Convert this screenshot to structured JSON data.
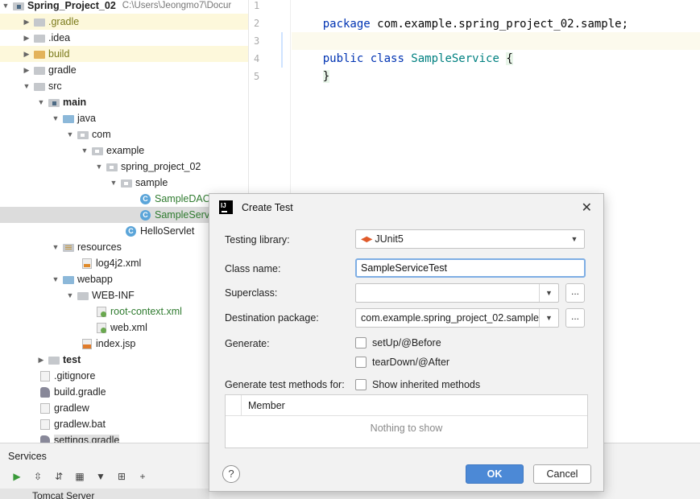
{
  "project_tree": {
    "root": {
      "label": "Spring_Project_02",
      "path": "C:\\Users\\Jeongmo7\\Docur"
    },
    "items": [
      {
        "label": ".gradle"
      },
      {
        "label": ".idea"
      },
      {
        "label": "build"
      },
      {
        "label": "gradle"
      },
      {
        "label": "src"
      },
      {
        "label": "main"
      },
      {
        "label": "java"
      },
      {
        "label": "com"
      },
      {
        "label": "example"
      },
      {
        "label": "spring_project_02"
      },
      {
        "label": "sample"
      },
      {
        "label": "SampleDAO"
      },
      {
        "label": "SampleServic"
      },
      {
        "label": "HelloServlet"
      },
      {
        "label": "resources"
      },
      {
        "label": "log4j2.xml"
      },
      {
        "label": "webapp"
      },
      {
        "label": "WEB-INF"
      },
      {
        "label": "root-context.xml"
      },
      {
        "label": "web.xml"
      },
      {
        "label": "index.jsp"
      },
      {
        "label": "test"
      },
      {
        "label": ".gitignore"
      },
      {
        "label": "build.gradle"
      },
      {
        "label": "gradlew"
      },
      {
        "label": "gradlew.bat"
      },
      {
        "label": "settings.gradle"
      }
    ],
    "class_icon_letter": "C",
    "jsp_icon_text": "JSP"
  },
  "editor": {
    "line_numbers": [
      "1",
      "2",
      "3",
      "4",
      "5"
    ],
    "lines": {
      "l1_keyword": "package",
      "l1_rest": " com.example.spring_project_02.sample;",
      "l3_kw1": "public",
      "l3_kw2": " class",
      "l3_name": " SampleService ",
      "l3_brace": "{",
      "l4_brace": "}"
    }
  },
  "services": {
    "title": "Services",
    "toolbar": [
      "run-icon",
      "expand-all-icon",
      "collapse-all-icon",
      "group-icon",
      "filter-icon",
      "new-service-icon",
      "add-icon"
    ],
    "item": "Tomcat Server"
  },
  "dialog": {
    "title": "Create Test",
    "testing_library_label": "Testing library:",
    "testing_library_value": "JUnit5",
    "class_name_label": "Class name:",
    "class_name_value": "SampleServiceTest",
    "superclass_label": "Superclass:",
    "superclass_value": "",
    "destination_label": "Destination package:",
    "destination_value": "com.example.spring_project_02.sample",
    "browse_label": "...",
    "generate_label": "Generate:",
    "setup_label": "setUp/@Before",
    "teardown_label": "tearDown/@After",
    "methods_label": "Generate test methods for:",
    "inherited_label": "Show inherited methods",
    "table_header": "Member",
    "table_empty": "Nothing to show",
    "help_label": "?",
    "ok_label": "OK",
    "cancel_label": "Cancel"
  }
}
